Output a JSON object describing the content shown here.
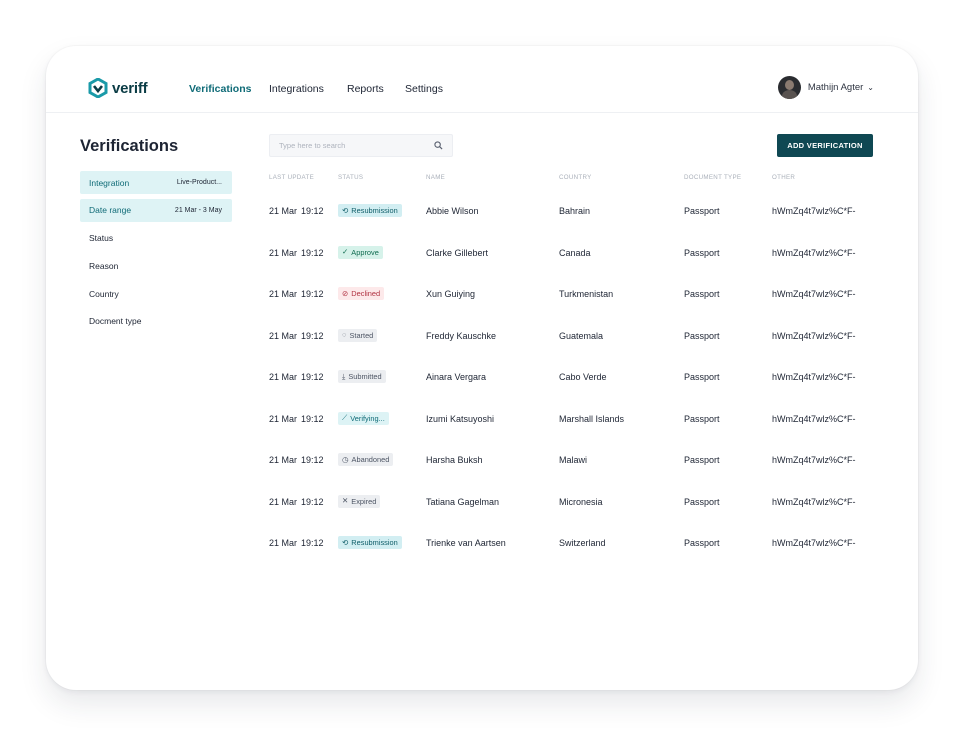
{
  "app": {
    "logo_text": "veriff"
  },
  "nav": {
    "items": [
      {
        "label": "Verifications",
        "active": true
      },
      {
        "label": "Integrations",
        "active": false
      },
      {
        "label": "Reports",
        "active": false
      },
      {
        "label": "Settings",
        "active": false
      }
    ]
  },
  "user": {
    "name": "Mathijn Agter",
    "chevron": "⌄"
  },
  "page": {
    "title": "Verifications"
  },
  "filters": [
    {
      "label": "Integration",
      "value": "Live-Product...",
      "active": true
    },
    {
      "label": "Date range",
      "value": "21 Mar  - 3 May",
      "active": true
    },
    {
      "label": "Status",
      "value": "",
      "active": false
    },
    {
      "label": "Reason",
      "value": "",
      "active": false
    },
    {
      "label": "Country",
      "value": "",
      "active": false
    },
    {
      "label": "Docment type",
      "value": "",
      "active": false
    }
  ],
  "search": {
    "placeholder": "Type here to search",
    "icon": "search-icon"
  },
  "add_button": {
    "label": "ADD VERIFICATION"
  },
  "table": {
    "headers": [
      "LAST UPDATE",
      "STATUS",
      "NAME",
      "COUNTRY",
      "DOCUMENT TYPE",
      "OTHER"
    ],
    "rows": [
      {
        "date": "21 Mar",
        "time": "19:12",
        "status": "Resubmission",
        "status_kind": "resub",
        "name": "Abbie Wilson",
        "country": "Bahrain",
        "doc": "Passport",
        "other": "hWmZq4t7wlz%C*F-"
      },
      {
        "date": "21 Mar",
        "time": "19:12",
        "status": "Approve",
        "status_kind": "approve",
        "name": "Clarke Gillebert",
        "country": "Canada",
        "doc": "Passport",
        "other": "hWmZq4t7wlz%C*F-"
      },
      {
        "date": "21 Mar",
        "time": "19:12",
        "status": "Declined",
        "status_kind": "declined",
        "name": "Xun Guiying",
        "country": "Turkmenistan",
        "doc": "Passport",
        "other": "hWmZq4t7wlz%C*F-"
      },
      {
        "date": "21 Mar",
        "time": "19:12",
        "status": "Started",
        "status_kind": "started",
        "name": "Freddy Kauschke",
        "country": "Guatemala",
        "doc": "Passport",
        "other": "hWmZq4t7wlz%C*F-"
      },
      {
        "date": "21 Mar",
        "time": "19:12",
        "status": "Submitted",
        "status_kind": "submitted",
        "name": "Ainara Vergara",
        "country": "Cabo Verde",
        "doc": "Passport",
        "other": "hWmZq4t7wlz%C*F-"
      },
      {
        "date": "21 Mar",
        "time": "19:12",
        "status": "Verifying...",
        "status_kind": "verifying",
        "name": "Izumi Katsuyoshi",
        "country": "Marshall Islands",
        "doc": "Passport",
        "other": "hWmZq4t7wlz%C*F-"
      },
      {
        "date": "21 Mar",
        "time": "19:12",
        "status": "Abandoned",
        "status_kind": "abandoned",
        "name": "Harsha Buksh",
        "country": "Malawi",
        "doc": "Passport",
        "other": "hWmZq4t7wlz%C*F-"
      },
      {
        "date": "21 Mar",
        "time": "19:12",
        "status": "Expired",
        "status_kind": "expired",
        "name": "Tatiana Gagelman",
        "country": "Micronesia",
        "doc": "Passport",
        "other": "hWmZq4t7wlz%C*F-"
      },
      {
        "date": "21 Mar",
        "time": "19:12",
        "status": "Resubmission",
        "status_kind": "resub",
        "name": "Trienke van Aartsen",
        "country": "Switzerland",
        "doc": "Passport",
        "other": "hWmZq4t7wlz%C*F-"
      }
    ]
  },
  "status_icons": {
    "resub": "⟲",
    "approve": "✓",
    "declined": "⊘",
    "started": "◌",
    "submitted": "⤓",
    "verifying": "⟋",
    "abandoned": "◷",
    "expired": "✕"
  },
  "colors": {
    "brand_dark": "#0f4853",
    "accent": "#0f6b77",
    "filter_active_bg": "#def3f5"
  }
}
